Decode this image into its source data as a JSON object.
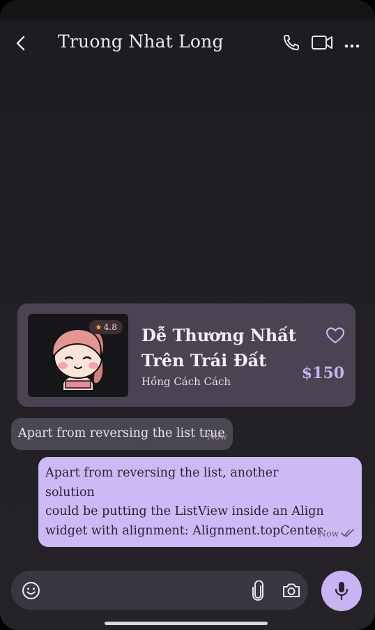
{
  "header": {
    "title": "Truong Nhat Long",
    "icons": [
      "chevron-left-icon",
      "phone-icon",
      "video-icon",
      "more-icon"
    ]
  },
  "card": {
    "rating": "4.8",
    "title_line1": "Dễ Thương Nhất",
    "title_line2": "Trên Trái Đất",
    "author": "Hồng Cách Cách",
    "price": "$150",
    "accent": "#c9b2f2"
  },
  "messages": [
    {
      "direction": "incoming",
      "text": "Apart from reversing the list true",
      "time": "Now"
    },
    {
      "direction": "outgoing",
      "lines": [
        "Apart from reversing the list, another solution",
        "could be putting the ListView inside an Align",
        "widget with alignment: Alignment.topCenter .",
        "Also shrinkWrap: true needed inside ListView"
      ],
      "time": "Now"
    }
  ],
  "composer": {
    "icons": [
      "emoji-icon",
      "attachment-icon",
      "camera-icon",
      "microphone-icon"
    ]
  },
  "colors": {
    "background": "#211f24",
    "outgoing_bubble": "#cdb9f6",
    "incoming_bubble": "#4b4750",
    "card": "#4a4352",
    "mic_button": "#c8b3f3"
  }
}
